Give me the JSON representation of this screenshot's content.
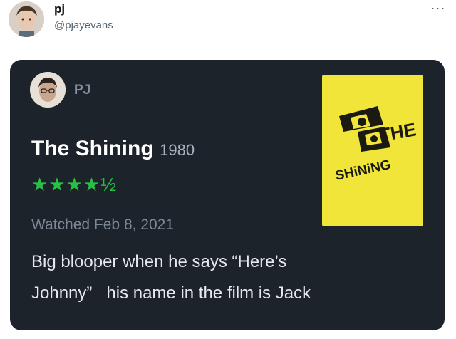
{
  "tweet": {
    "author_name": "pj",
    "author_handle": "@pjayevans",
    "more_icon": "more-horizontal-icon",
    "more_glyph": "···"
  },
  "card": {
    "username": "PJ",
    "film_title": "The Shining",
    "film_year": "1980",
    "rating_text": "★★★★½",
    "watched": "Watched Feb 8, 2021",
    "review_lines": [
      "Big blooper when he says “Here’s",
      "Johnny”   his name in the film is Jack"
    ],
    "poster": {
      "text_the": "THE",
      "text_shining": "SHiNiNG"
    }
  },
  "colors": {
    "card_bg": "#1d232b",
    "rating_green": "#27c143",
    "poster_yellow": "#f1e53a"
  }
}
